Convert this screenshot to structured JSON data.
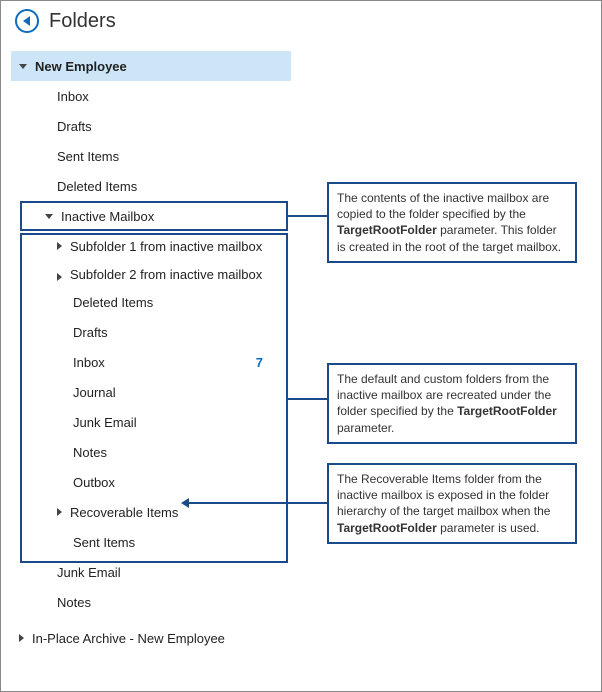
{
  "header": {
    "title": "Folders"
  },
  "tree": {
    "root": "New Employee",
    "inbox": "Inbox",
    "drafts": "Drafts",
    "sent": "Sent Items",
    "deleted": "Deleted Items",
    "inactive": "Inactive Mailbox",
    "sub1": "Subfolder 1 from inactive mailbox",
    "sub2": "Subfolder 2 from inactive mailbox",
    "im_deleted": "Deleted Items",
    "im_drafts": "Drafts",
    "im_inbox": "Inbox",
    "im_inbox_count": "7",
    "im_journal": "Journal",
    "im_junk": "Junk Email",
    "im_notes": "Notes",
    "im_outbox": "Outbox",
    "im_recoverable": "Recoverable Items",
    "im_sent": "Sent Items",
    "junk": "Junk Email",
    "notes": "Notes",
    "archive": "In-Place Archive - New Employee"
  },
  "callouts": {
    "c1a": "The contents of the inactive mailbox are copied to the folder specified by the ",
    "c1b": "TargetRootFolder",
    "c1c": " parameter. This folder is created in the root of the target mailbox.",
    "c2a": "The default and custom folders from the inactive mailbox are recreated under the folder specified by the ",
    "c2b": "TargetRootFolder",
    "c2c": " parameter.",
    "c3a": "The Recoverable Items folder from the inactive mailbox is exposed in the folder hierarchy of the target mailbox when the ",
    "c3b": "TargetRootFolder",
    "c3c": " parameter is used."
  }
}
